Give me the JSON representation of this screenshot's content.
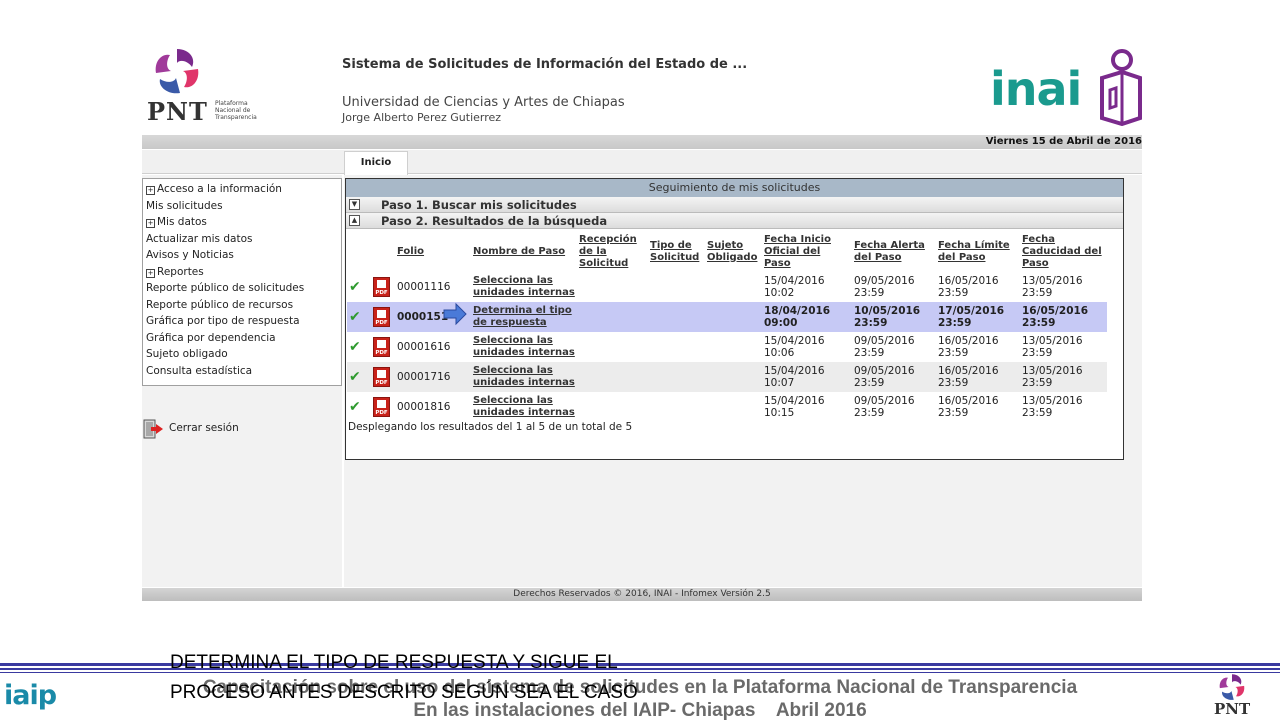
{
  "header": {
    "pnt_logo_word": "PNT",
    "pnt_logo_sub": "Plataforma Nacional de Transparencia",
    "system_title": "Sistema de Solicitudes de Información del Estado de ...",
    "organization": "Universidad de Ciencias y Artes de Chiapas",
    "user": "Jorge Alberto Perez Gutierrez",
    "inai_word": "inai",
    "date": "Viernes 15 de Abril de 2016"
  },
  "tabs": [
    {
      "label": "Inicio"
    }
  ],
  "sidebar": {
    "items": [
      {
        "label": "Acceso a la información",
        "icon": "expand-box-icon"
      },
      {
        "label": "Mis solicitudes"
      },
      {
        "label": "Mis datos",
        "icon": "expand-box-icon"
      },
      {
        "label": "Actualizar mis datos"
      },
      {
        "label": "Avisos y Noticias"
      },
      {
        "label": "Reportes",
        "icon": "expand-box-icon"
      },
      {
        "label": "Reporte público de solicitudes"
      },
      {
        "label": "Reporte público de recursos"
      },
      {
        "label": "Gráfica por tipo de respuesta"
      },
      {
        "label": "Gráfica por dependencia"
      },
      {
        "label": "Sujeto obligado"
      },
      {
        "label": "Consulta estadística"
      }
    ],
    "logout": "Cerrar sesión"
  },
  "panel": {
    "title": "Seguimiento de mis solicitudes",
    "step1": "Paso 1. Buscar mis solicitudes",
    "step2": "Paso 2. Resultados de la búsqueda",
    "columns": [
      "Folio",
      "Nombre de Paso",
      "Recepción de la Solicitud",
      "Tipo de Solicitud",
      "Sujeto Obligado",
      "Fecha Inicio Oficial del Paso",
      "Fecha Alerta del Paso",
      "Fecha Límite del Paso",
      "Fecha Caducidad del Paso"
    ],
    "rows": [
      {
        "folio": "00001116",
        "paso": "Selecciona las unidades internas",
        "inicio": "15/04/2016 10:02",
        "alerta": "09/05/2016 23:59",
        "limite": "16/05/2016 23:59",
        "caducidad": "13/05/2016 23:59"
      },
      {
        "folio": "0000151",
        "paso": "Determina el tipo de respuesta",
        "inicio": "18/04/2016 09:00",
        "alerta": "10/05/2016 23:59",
        "limite": "17/05/2016 23:59",
        "caducidad": "16/05/2016 23:59"
      },
      {
        "folio": "00001616",
        "paso": "Selecciona las unidades internas",
        "inicio": "15/04/2016 10:06",
        "alerta": "09/05/2016 23:59",
        "limite": "16/05/2016 23:59",
        "caducidad": "13/05/2016 23:59"
      },
      {
        "folio": "00001716",
        "paso": "Selecciona las unidades internas",
        "inicio": "15/04/2016 10:07",
        "alerta": "09/05/2016 23:59",
        "limite": "16/05/2016 23:59",
        "caducidad": "13/05/2016 23:59"
      },
      {
        "folio": "00001816",
        "paso": "Selecciona las unidades internas",
        "inicio": "15/04/2016 10:15",
        "alerta": "09/05/2016 23:59",
        "limite": "16/05/2016 23:59",
        "caducidad": "13/05/2016 23:59"
      }
    ],
    "summary": "Desplegando los resultados del 1 al 5 de un total de 5"
  },
  "footer_bar": "Derechos Reservados © 2016, INAI - Infomex Versión 2.5",
  "slide": {
    "note_line1": "DETERMINA EL TIPO DE RESPUESTA Y SIGUE EL",
    "note_line2": "PROCESO ANTES DESCRITO SEGÚN SEA EL CASO",
    "footer_line1": "Capacitación sobre el uso del sistema de solicitudes en la Plataforma Nacional de Transparencia",
    "footer_line2": "En las instalaciones del IAIP- Chiapas    Abril 2016",
    "iaip_word": "iaip",
    "pnt_word": "PNT"
  },
  "colors": {
    "highlight_row": "#c6c9f5",
    "panel_title_bg": "#a8b8c8",
    "check_green": "#2e9a2e",
    "inai_teal": "#1a9a8e",
    "pnt_purple": "#6a2a8a"
  }
}
